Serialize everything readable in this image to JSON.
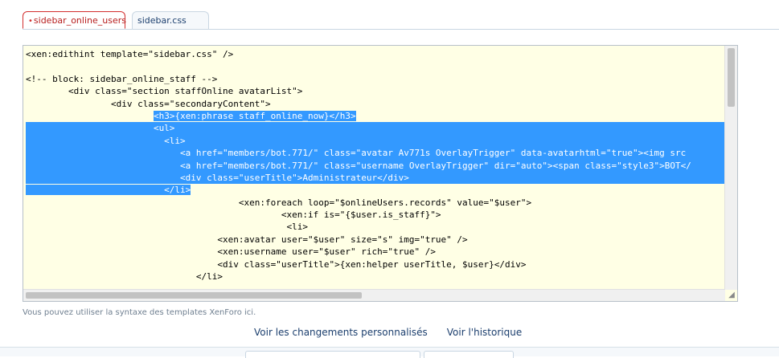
{
  "tabs": [
    {
      "label": "sidebar_online_users",
      "modified": true,
      "active": true
    },
    {
      "label": "sidebar.css",
      "modified": false,
      "active": false
    }
  ],
  "editor": {
    "lines": [
      "<xen:edithint template=\"sidebar.css\" />",
      "",
      "<!-- block: sidebar_online_staff -->",
      "        <div class=\"section staffOnline avatarList\">",
      "                <div class=\"secondaryContent\">",
      "                        <h3>{xen:phrase staff_online_now}</h3>",
      "                        <ul>",
      "                          <li>",
      "                             <a href=\"members/bot.771/\" class=\"avatar Av771s OverlayTrigger\" data-avatarhtml=\"true\"><img src",
      "                             <a href=\"members/bot.771/\" class=\"username OverlayTrigger\" dir=\"auto\"><span class=\"style3\">BOT</",
      "                             <div class=\"userTitle\">Administrateur</div>",
      "                          </li>",
      "                                        <xen:foreach loop=\"$onlineUsers.records\" value=\"$user\">",
      "                                                <xen:if is=\"{$user.is_staff}\">",
      "                                                 <li>",
      "                                    <xen:avatar user=\"$user\" size=\"s\" img=\"true\" />",
      "                                    <xen:username user=\"$user\" rich=\"true\" />",
      "                                    <div class=\"userTitle\">{xen:helper userTitle, $user}</div>",
      "                                </li>"
    ]
  },
  "hint": "Vous pouvez utiliser la syntaxe des templates XenForo ici.",
  "links": {
    "changes": "Voir les changements personnalisés",
    "history": "Voir l'historique"
  }
}
